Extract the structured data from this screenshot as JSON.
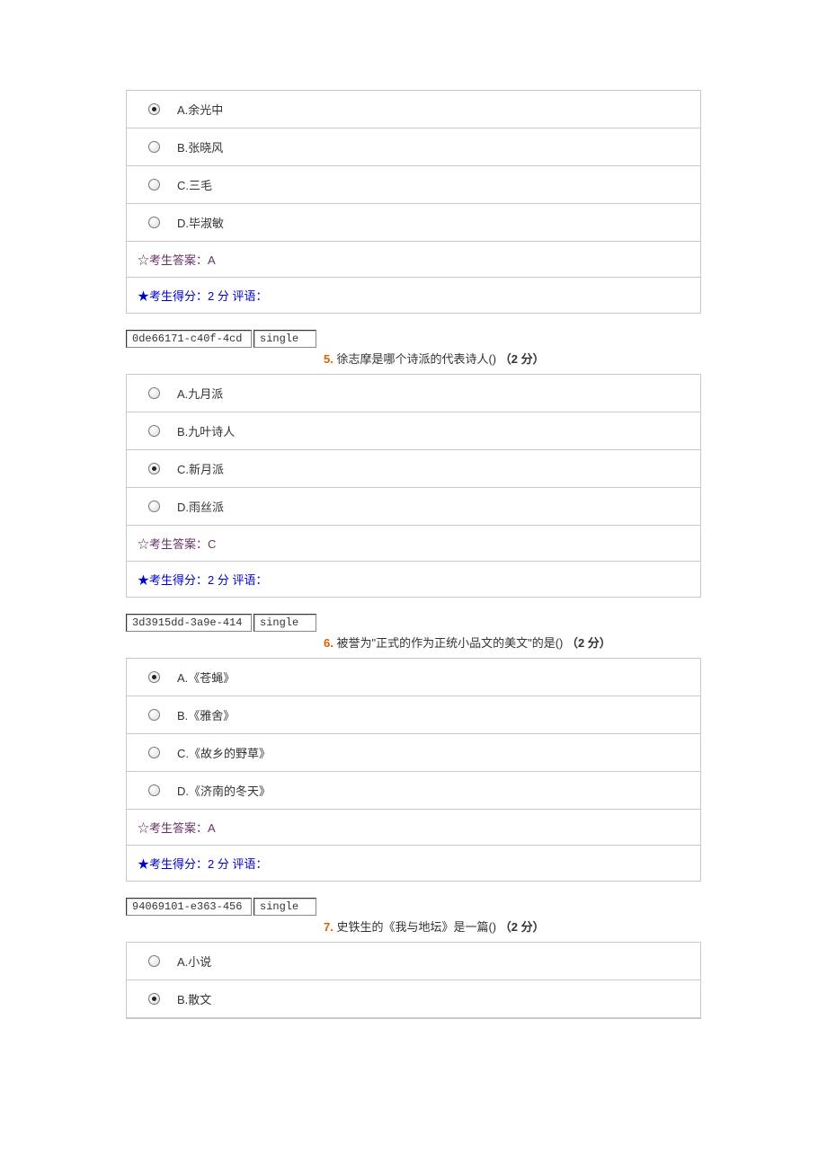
{
  "questions": [
    {
      "number": "",
      "stem": "",
      "points": "",
      "id_box": "",
      "type_box": "",
      "show_header": false,
      "options": [
        {
          "label": "A.余光中",
          "checked": true
        },
        {
          "label": "B.张晓风",
          "checked": false
        },
        {
          "label": "C.三毛",
          "checked": false
        },
        {
          "label": "D.毕淑敏",
          "checked": false
        }
      ],
      "answer_label": "☆考生答案：A",
      "score_label": "★考生得分：2 分  评语："
    },
    {
      "number": "5.",
      "stem": "徐志摩是哪个诗派的代表诗人() ",
      "points": "（2 分）",
      "id_box": "0de66171-c40f-4cd",
      "type_box": "single",
      "show_header": true,
      "options": [
        {
          "label": "A.九月派",
          "checked": false
        },
        {
          "label": "B.九叶诗人",
          "checked": false
        },
        {
          "label": "C.新月派",
          "checked": true
        },
        {
          "label": "D.雨丝派",
          "checked": false
        }
      ],
      "answer_label": "☆考生答案：C",
      "score_label": "★考生得分：2 分  评语："
    },
    {
      "number": "6.",
      "stem": "被誉为\"正式的作为正统小品文的美文\"的是() ",
      "points": "（2 分）",
      "id_box": "3d3915dd-3a9e-414",
      "type_box": "single",
      "show_header": true,
      "options": [
        {
          "label": "A.《苍蝇》",
          "checked": true
        },
        {
          "label": "B.《雅舍》",
          "checked": false
        },
        {
          "label": "C.《故乡的野草》",
          "checked": false
        },
        {
          "label": "D.《济南的冬天》",
          "checked": false
        }
      ],
      "answer_label": "☆考生答案：A",
      "score_label": "★考生得分：2 分  评语："
    },
    {
      "number": "7.",
      "stem": "史铁生的《我与地坛》是一篇() ",
      "points": "（2 分）",
      "id_box": "94069101-e363-456",
      "type_box": "single",
      "show_header": true,
      "options": [
        {
          "label": "A.小说",
          "checked": false
        },
        {
          "label": "B.散文",
          "checked": true
        }
      ],
      "answer_label": "",
      "score_label": ""
    }
  ]
}
